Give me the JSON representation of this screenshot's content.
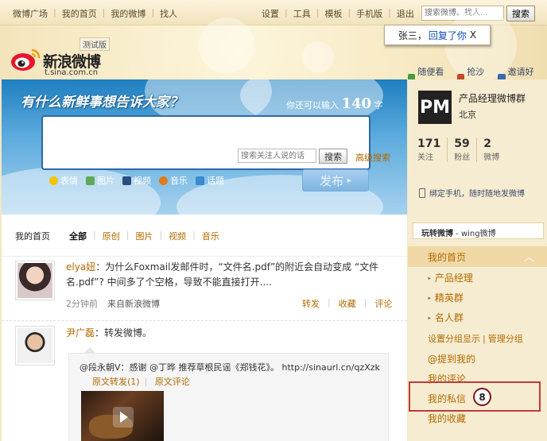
{
  "topbar": {
    "left_links": [
      "微博广场",
      "我的首页",
      "我的微博",
      "找人"
    ],
    "right_links": [
      "设置",
      "工具",
      "模板",
      "手机版",
      "退出"
    ],
    "search_placeholder": "搜索微博、找人...",
    "search_button": "搜索"
  },
  "header": {
    "logo_text": "新浪微博",
    "logo_url": "t.sina.com.cn",
    "beta": "测试版",
    "notice": {
      "name": "张三，",
      "link": "回复了你",
      "close": "X"
    },
    "links": [
      "随便看看",
      "抢沙发",
      "邀请好友"
    ]
  },
  "publisher": {
    "title": "有什么新鲜事想告诉大家？",
    "count_prefix": "你还可以输入",
    "count_value": "140",
    "count_suffix": "字",
    "tools": [
      "表情",
      "图片",
      "视频",
      "音乐",
      "话题"
    ],
    "submit": "发布"
  },
  "feedbar": {
    "home": "我的首页",
    "filters": [
      "全部",
      "原创",
      "图片",
      "视频",
      "音乐"
    ],
    "search_placeholder": "搜索关注人说的话",
    "search_button": "搜索",
    "advanced": "高级搜索"
  },
  "posts": [
    {
      "author": "elya妞",
      "text": "：为什么Foxmail发邮件时，“文件名.pdf”的附近会自动变成 “文件名.pdf”? 中间多了个空格，导致不能直接打开....",
      "time": "2分钟前",
      "source": "来自新浪微博",
      "actions": [
        "转发",
        "收藏",
        "评论"
      ]
    },
    {
      "author": "尹广磊",
      "text": "：转发微博。",
      "repost_line": "@段永朝V：感谢 @丁晔 推荐草根民谣《郑钱花》。 http://sinaurl.cn/qzXzk",
      "repost_links": [
        "原文转发(1)",
        "原文评论"
      ]
    }
  ],
  "profile": {
    "avatar_text": "PM",
    "name": "产品经理微博群",
    "location": "北京",
    "stats": [
      {
        "value": "171",
        "label": "关注"
      },
      {
        "value": "59",
        "label": "粉丝"
      },
      {
        "value": "2",
        "label": "微博"
      }
    ],
    "bind_phone": "绑定手机，随时随地发微博"
  },
  "sidebar": {
    "wing_prefix": "玩转微博",
    "wing_name": " - wing微博",
    "menu_head": "我的首页",
    "groups": [
      "产品经理",
      "精英群",
      "名人群"
    ],
    "group_links": [
      "设置分组显示",
      "管理分组"
    ],
    "items": [
      "@提到我的",
      "我的评论",
      "我的私信",
      "我的收藏"
    ],
    "badge": "8"
  }
}
